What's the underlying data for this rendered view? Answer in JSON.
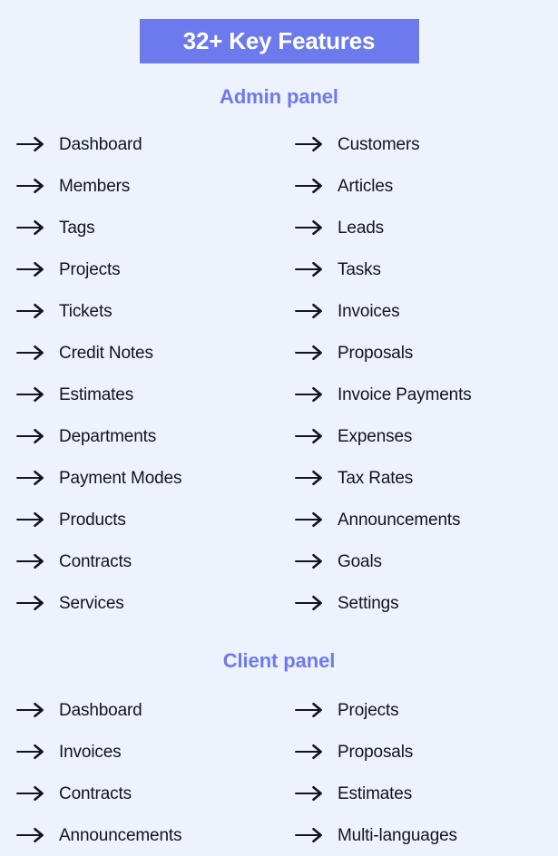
{
  "background_color": "#eef2fc",
  "accent_color": "#6c7aee",
  "text_color": "#121420",
  "badge": {
    "label": "32+ Key Features",
    "background_color": "#6c7aee",
    "text_color": "#ffffff"
  },
  "sections": [
    {
      "id": "admin-panel",
      "heading": "Admin panel",
      "icon": "arrow-right-icon",
      "items": [
        {
          "label": "Dashboard",
          "column": "left"
        },
        {
          "label": "Customers",
          "column": "right"
        },
        {
          "label": "Members",
          "column": "left"
        },
        {
          "label": "Articles",
          "column": "right"
        },
        {
          "label": "Tags",
          "column": "left"
        },
        {
          "label": "Leads",
          "column": "right"
        },
        {
          "label": "Projects",
          "column": "left"
        },
        {
          "label": "Tasks",
          "column": "right"
        },
        {
          "label": "Tickets",
          "column": "left"
        },
        {
          "label": "Invoices",
          "column": "right"
        },
        {
          "label": "Credit Notes",
          "column": "left"
        },
        {
          "label": "Proposals",
          "column": "right"
        },
        {
          "label": "Estimates",
          "column": "left"
        },
        {
          "label": "Invoice Payments",
          "column": "right"
        },
        {
          "label": "Departments",
          "column": "left"
        },
        {
          "label": "Expenses",
          "column": "right"
        },
        {
          "label": "Payment Modes",
          "column": "left"
        },
        {
          "label": "Tax Rates",
          "column": "right"
        },
        {
          "label": "Products",
          "column": "left"
        },
        {
          "label": "Announcements",
          "column": "right"
        },
        {
          "label": "Contracts",
          "column": "left"
        },
        {
          "label": "Goals",
          "column": "right"
        },
        {
          "label": "Services",
          "column": "left"
        },
        {
          "label": "Settings",
          "column": "right"
        }
      ]
    },
    {
      "id": "client-panel",
      "heading": "Client panel",
      "icon": "arrow-right-icon",
      "items": [
        {
          "label": "Dashboard",
          "column": "left"
        },
        {
          "label": "Projects",
          "column": "right"
        },
        {
          "label": "Invoices",
          "column": "left"
        },
        {
          "label": "Proposals",
          "column": "right"
        },
        {
          "label": "Contracts",
          "column": "left"
        },
        {
          "label": "Estimates",
          "column": "right"
        },
        {
          "label": "Announcements",
          "column": "left"
        },
        {
          "label": "Multi-languages",
          "column": "right"
        }
      ]
    }
  ]
}
